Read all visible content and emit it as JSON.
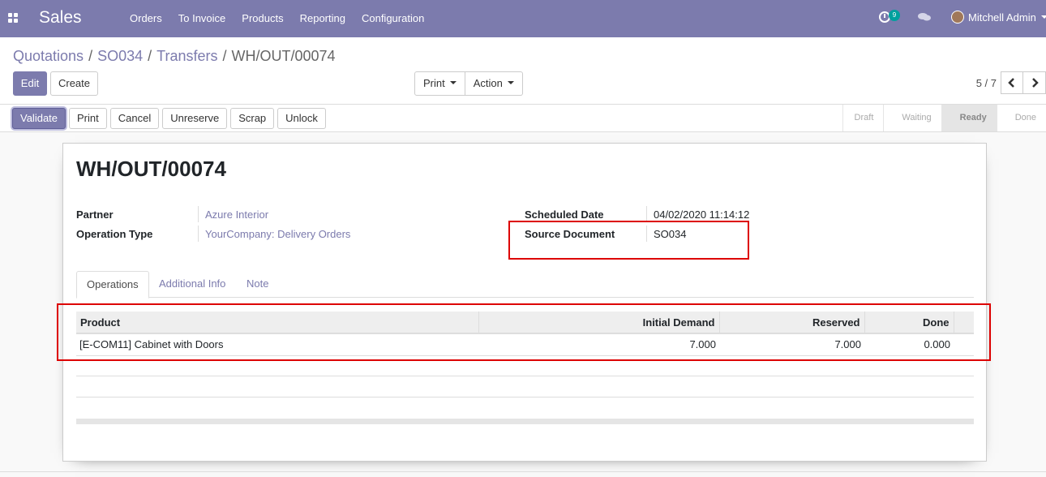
{
  "navbar": {
    "app_name": "Sales",
    "menu": [
      "Orders",
      "To Invoice",
      "Products",
      "Reporting",
      "Configuration"
    ],
    "activity_count": "9",
    "user_name": "Mitchell Admin",
    "color": "#7c7bad"
  },
  "breadcrumb": {
    "items": [
      "Quotations",
      "SO034",
      "Transfers"
    ],
    "current": "WH/OUT/00074"
  },
  "buttons": {
    "edit": "Edit",
    "create": "Create",
    "print": "Print",
    "action": "Action"
  },
  "pager": {
    "value": "5 / 7",
    "prev_icon": "chevron-left-icon",
    "next_icon": "chevron-right-icon"
  },
  "statusbar": {
    "actions": [
      "Validate",
      "Print",
      "Cancel",
      "Unreserve",
      "Scrap",
      "Unlock"
    ],
    "stages": [
      "Draft",
      "Waiting",
      "Ready",
      "Done"
    ],
    "active_stage": "Ready"
  },
  "record": {
    "title": "WH/OUT/00074",
    "partner_label": "Partner",
    "partner": "Azure Interior",
    "operation_type_label": "Operation Type",
    "operation_type": "YourCompany: Delivery Orders",
    "scheduled_date_label": "Scheduled Date",
    "scheduled_date": "04/02/2020 11:14:12",
    "source_document_label": "Source Document",
    "source_document": "SO034"
  },
  "tabs": [
    "Operations",
    "Additional Info",
    "Note"
  ],
  "table": {
    "columns": [
      "Product",
      "Initial Demand",
      "Reserved",
      "Done"
    ],
    "rows": [
      [
        "[E-COM11] Cabinet with Doors",
        "7.000",
        "7.000",
        "0.000"
      ]
    ]
  },
  "highlight_color": "#dd0000"
}
